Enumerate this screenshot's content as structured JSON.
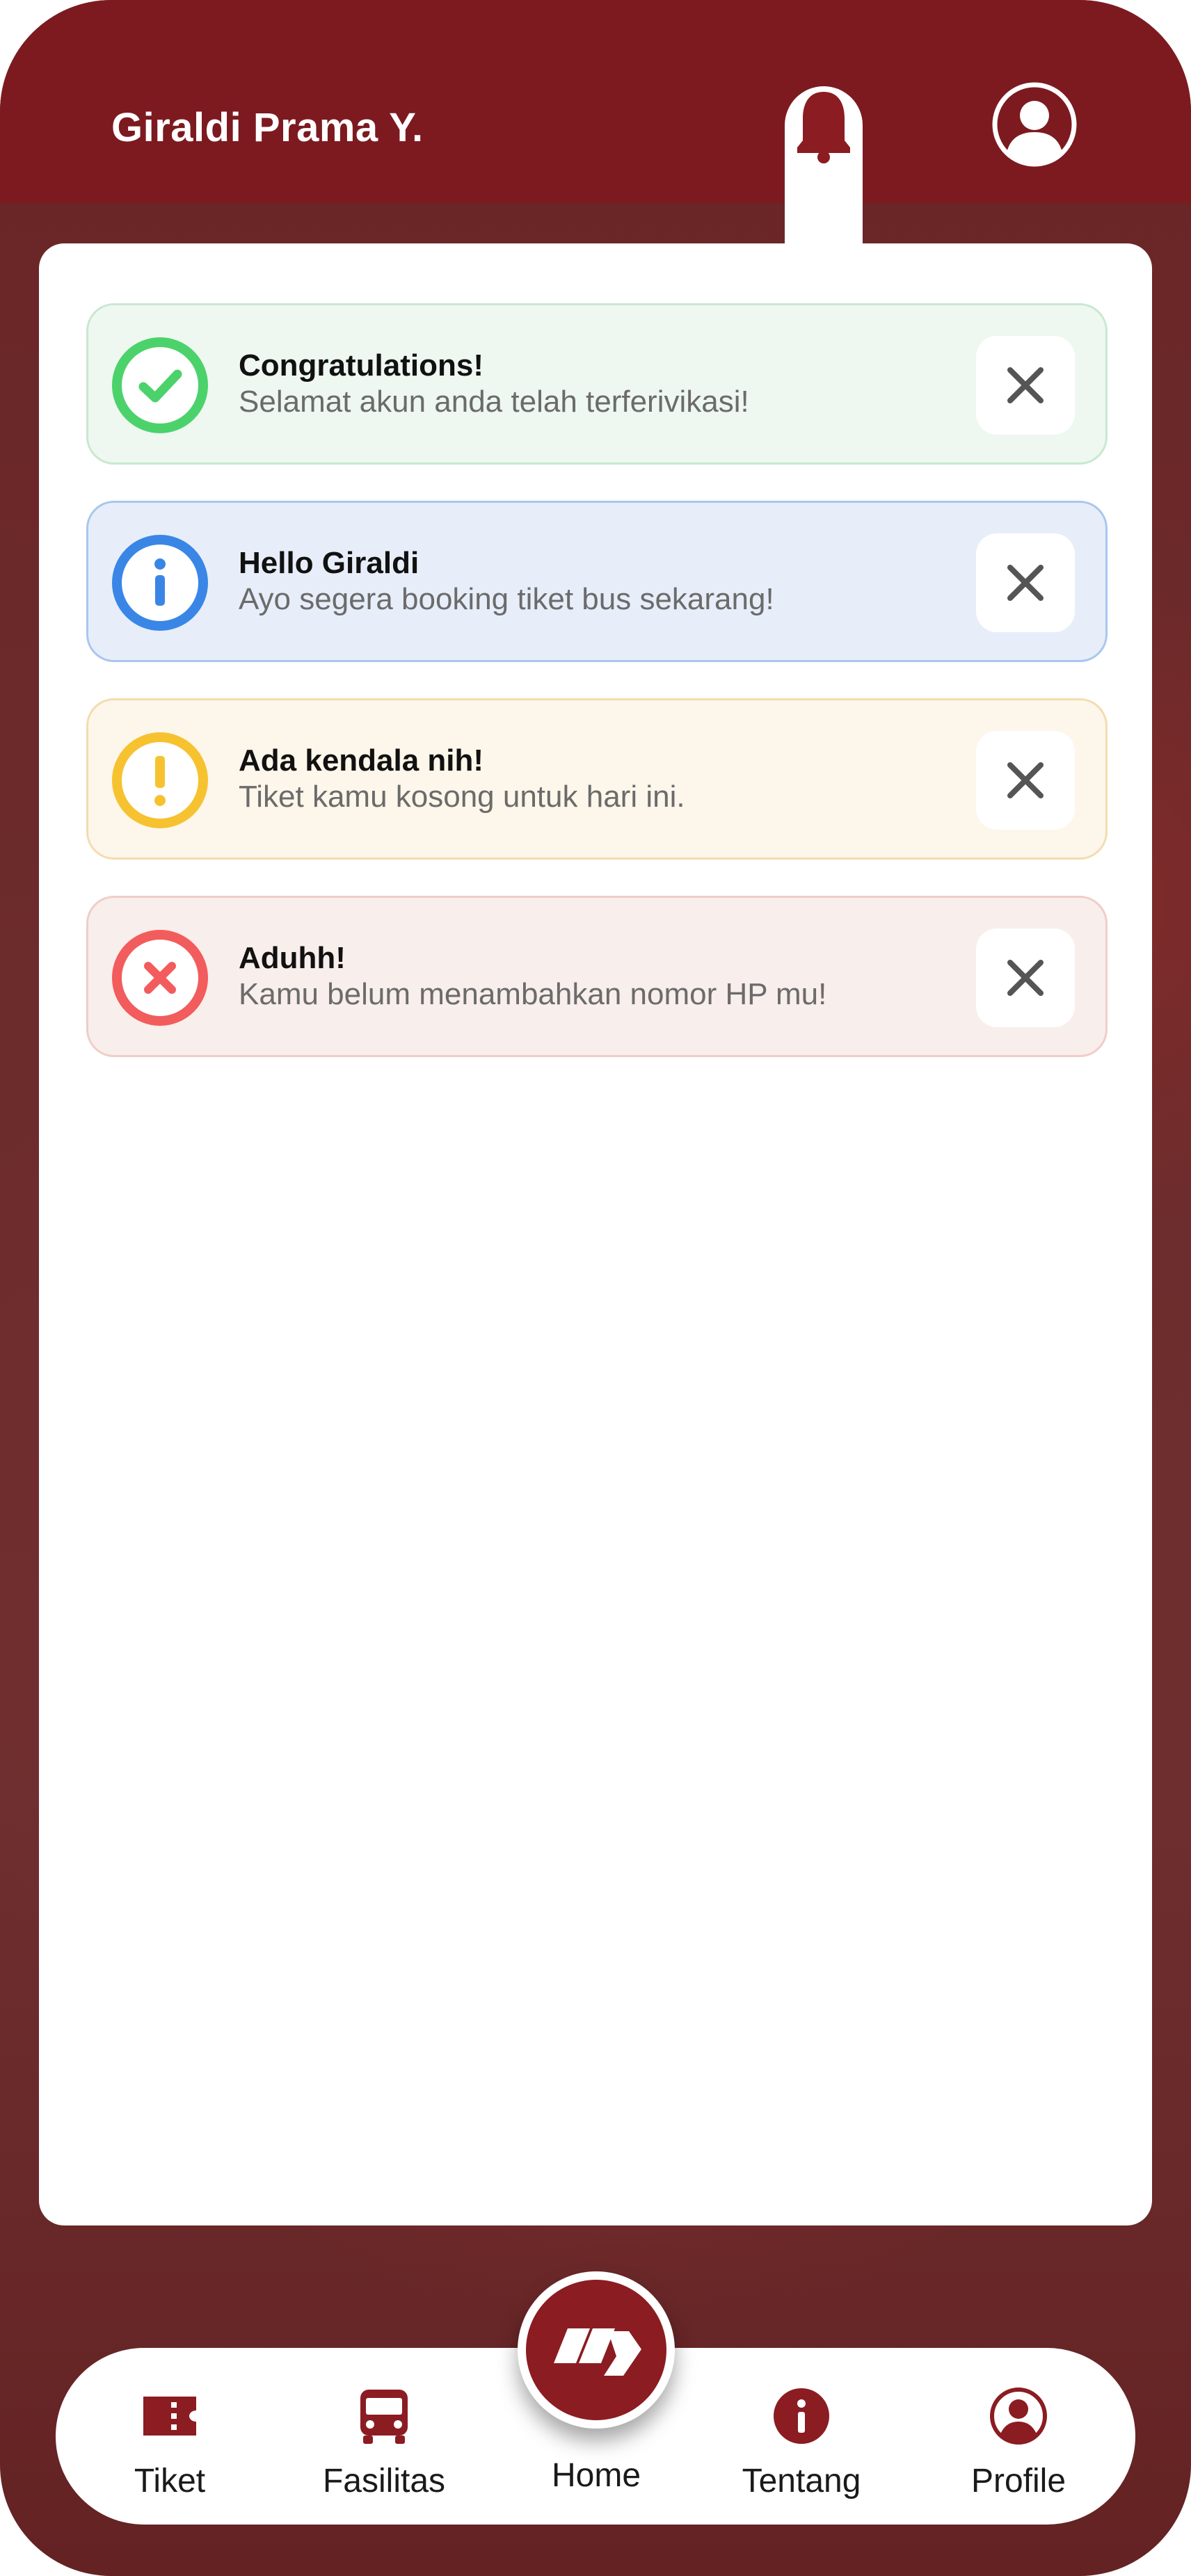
{
  "header": {
    "user_name": "Giraldi Prama Y."
  },
  "notifications": [
    {
      "type": "success",
      "title": "Congratulations!",
      "message": "Selamat akun anda telah terferivikasi!",
      "accent": "#4cd26b",
      "bg": "#eef7f0",
      "border": "#c9e8d0",
      "icon": "check-circle-icon"
    },
    {
      "type": "info",
      "title": "Hello Giraldi",
      "message": "Ayo segera booking tiket bus sekarang!",
      "accent": "#3a86e6",
      "bg": "#e7eef9",
      "border": "#a9c6ee",
      "icon": "info-circle-icon"
    },
    {
      "type": "warning",
      "title": "Ada kendala nih!",
      "message": "Tiket kamu kosong untuk hari ini.",
      "accent": "#f6c230",
      "bg": "#fdf6ea",
      "border": "#f3dcb0",
      "icon": "exclamation-circle-icon"
    },
    {
      "type": "error",
      "title": "Aduhh!",
      "message": "Kamu belum menambahkan nomor HP mu!",
      "accent": "#f25c5c",
      "bg": "#f8eeeb",
      "border": "#f0cdc8",
      "icon": "x-circle-icon"
    }
  ],
  "nav": {
    "items": [
      {
        "label": "Tiket",
        "icon": "ticket-icon"
      },
      {
        "label": "Fasilitas",
        "icon": "bus-icon"
      },
      {
        "label": "Home",
        "icon": "home-logo-icon"
      },
      {
        "label": "Tentang",
        "icon": "info-icon"
      },
      {
        "label": "Profile",
        "icon": "profile-icon"
      }
    ]
  },
  "colors": {
    "brand": "#7c1a20",
    "brand_dark": "#8b1c22",
    "close_icon": "#555555"
  }
}
